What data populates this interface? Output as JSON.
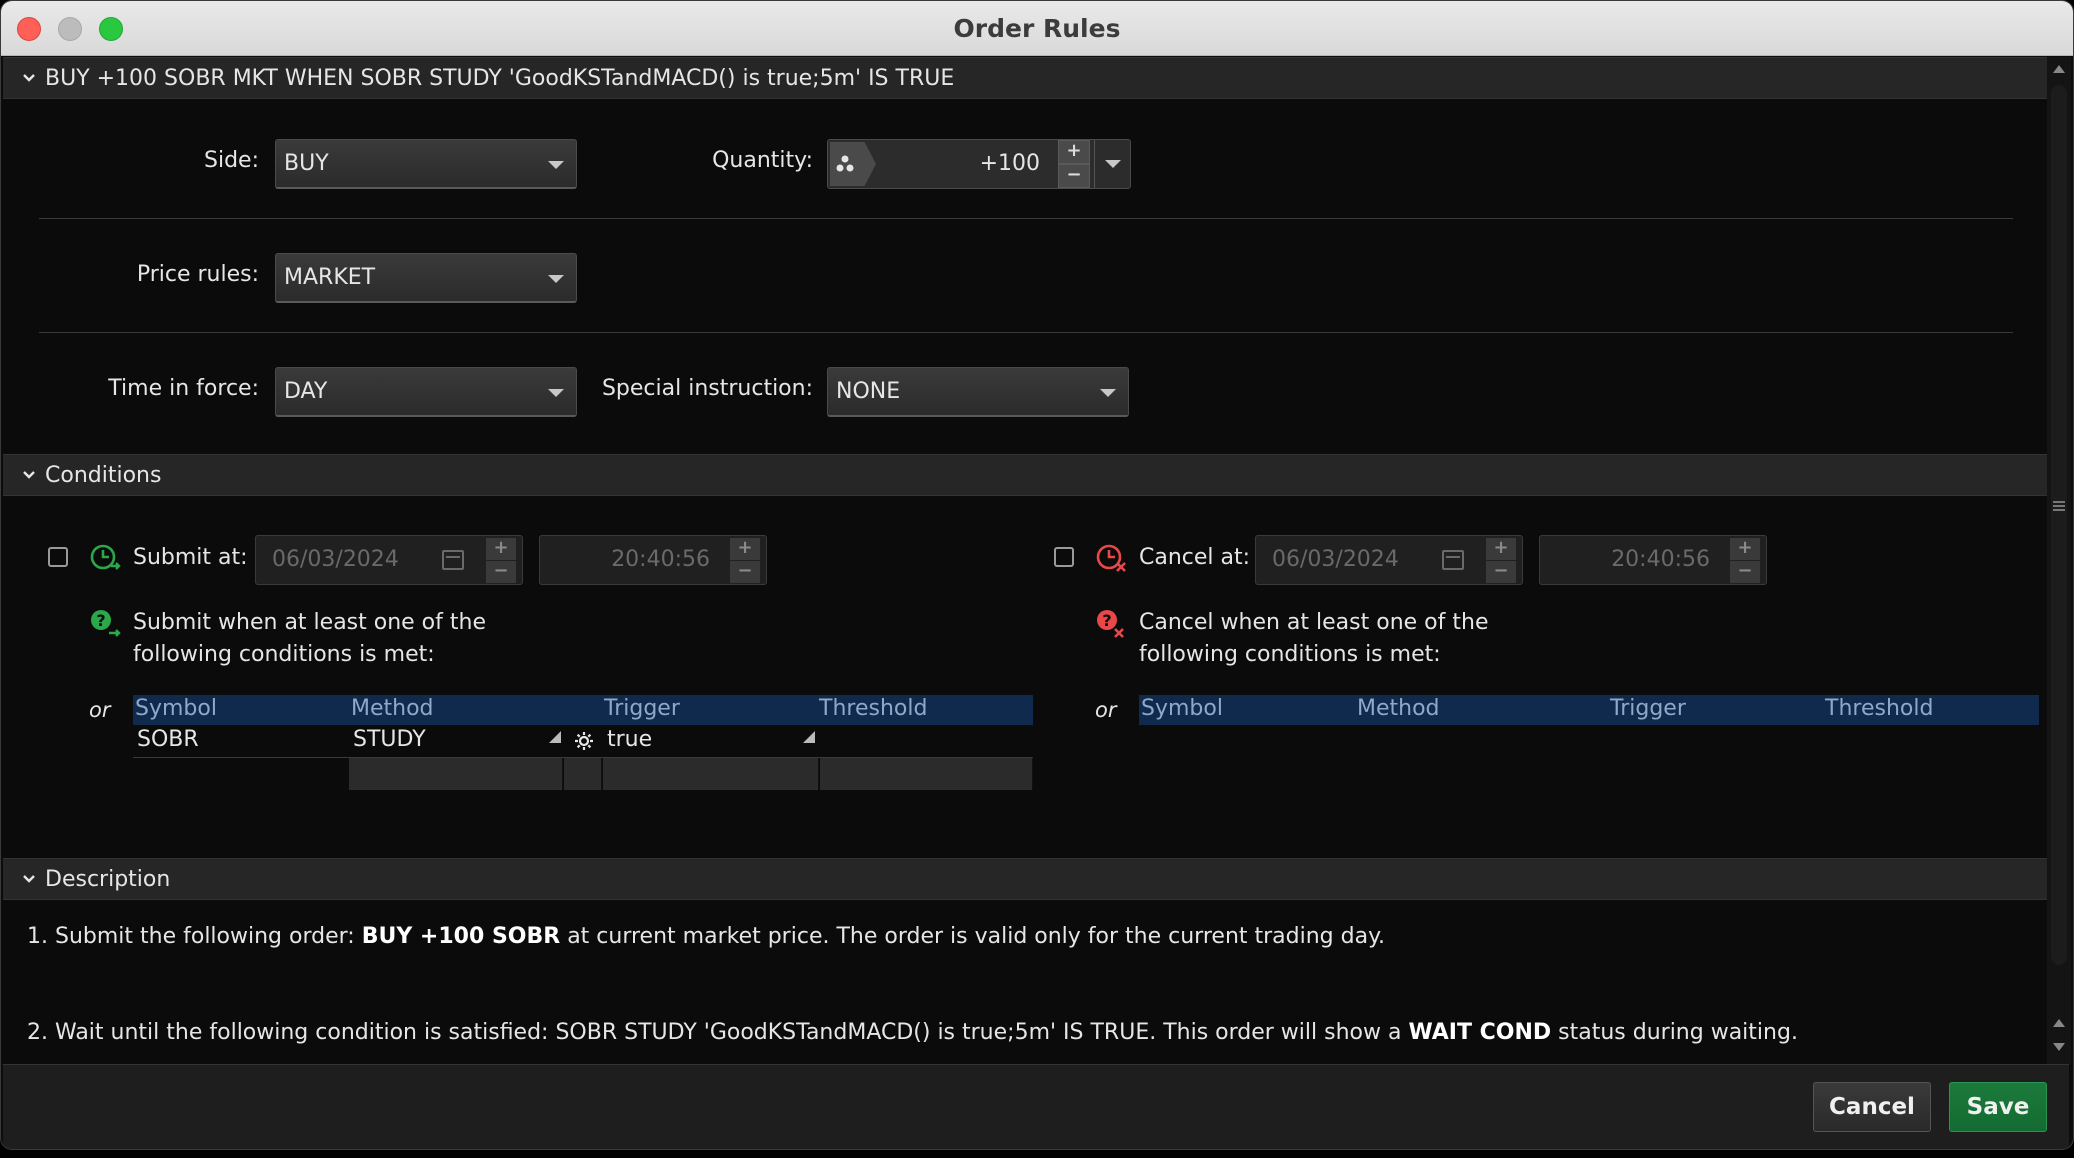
{
  "window": {
    "title": "Order Rules"
  },
  "order_section": {
    "header": "BUY +100 SOBR MKT WHEN SOBR STUDY 'GoodKSTandMACD() is true;5m' IS TRUE"
  },
  "side": {
    "label": "Side:",
    "value": "BUY"
  },
  "quantity": {
    "label": "Quantity:",
    "value": "+100"
  },
  "price_rules": {
    "label": "Price rules:",
    "value": "MARKET"
  },
  "time_in_force": {
    "label": "Time in force:",
    "value": "DAY"
  },
  "special_instruction": {
    "label": "Special instruction:",
    "value": "NONE"
  },
  "conditions": {
    "header": "Conditions",
    "submit": {
      "label": "Submit at:",
      "date": "06/03/2024",
      "time": "20:40:56",
      "note_line1": "Submit when at least one of the",
      "note_line2": "following conditions is met:",
      "or": "or",
      "columns": [
        "Symbol",
        "Method",
        "Trigger",
        "Threshold"
      ],
      "rows": [
        {
          "symbol": "SOBR",
          "method": "STUDY",
          "trigger": "true",
          "threshold": ""
        }
      ]
    },
    "cancel": {
      "label": "Cancel at:",
      "date": "06/03/2024",
      "time": "20:40:56",
      "note_line1": "Cancel when at least one of the",
      "note_line2": "following conditions is met:",
      "or": "or",
      "columns": [
        "Symbol",
        "Method",
        "Trigger",
        "Threshold"
      ]
    }
  },
  "description": {
    "header": "Description",
    "line1_pre": "1. Submit the following order: ",
    "line1_bold": "BUY +100 SOBR",
    "line1_post": " at current market price. The order is valid only for the current trading day.",
    "line2_pre": "2. Wait until the following condition is satisfied: SOBR STUDY 'GoodKSTandMACD() is true;5m' IS TRUE. This order will show a ",
    "line2_bold": "WAIT COND",
    "line2_post": " status during waiting."
  },
  "buttons": {
    "cancel": "Cancel",
    "save": "Save"
  },
  "colors": {
    "save": "#136b31",
    "table_header": "#102a4e",
    "submit_icon": "#2aa84a",
    "cancel_icon": "#e84848"
  }
}
